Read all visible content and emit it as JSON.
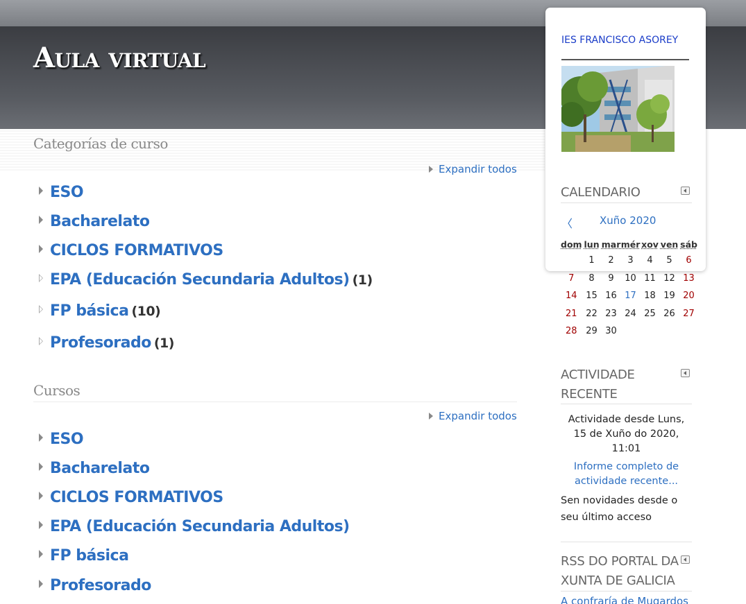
{
  "header": {
    "site_title": "Aula virtual"
  },
  "categories_section": {
    "title": "Categorías de curso",
    "expand_label": "Expandir todos",
    "items": [
      {
        "label": "ESO",
        "count": ""
      },
      {
        "label": "Bacharelato",
        "count": ""
      },
      {
        "label": "CICLOS FORMATIVOS",
        "count": ""
      },
      {
        "label": "EPA (Educación Secundaria Adultos)",
        "count": "(1)"
      },
      {
        "label": "FP básica",
        "count": "(10)"
      },
      {
        "label": "Profesorado",
        "count": "(1)"
      }
    ]
  },
  "courses_section": {
    "title": "Cursos",
    "expand_label": "Expandir todos",
    "items": [
      {
        "label": "ESO"
      },
      {
        "label": "Bacharelato"
      },
      {
        "label": "CICLOS FORMATIVOS"
      },
      {
        "label": "EPA (Educación Secundaria Adultos)"
      },
      {
        "label": "FP básica"
      },
      {
        "label": "Profesorado"
      }
    ]
  },
  "sidebar": {
    "school_name": "IES FRANCISCO ASOREY",
    "calendar": {
      "title": "CALENDARIO",
      "prev_symbol": "〈",
      "month": "Xuño 2020",
      "weekdays": [
        "dom",
        "lun",
        "mar",
        "mér",
        "xov",
        "ven",
        "sáb"
      ],
      "weeks": [
        [
          "",
          "1",
          "2",
          "3",
          "4",
          "5",
          "6"
        ],
        [
          "7",
          "8",
          "9",
          "10",
          "11",
          "12",
          "13"
        ],
        [
          "14",
          "15",
          "16",
          "17",
          "18",
          "19",
          "20"
        ],
        [
          "21",
          "22",
          "23",
          "24",
          "25",
          "26",
          "27"
        ],
        [
          "28",
          "29",
          "30",
          "",
          "",
          "",
          ""
        ]
      ],
      "today": "17"
    },
    "recent": {
      "title_line1": "ACTIVIDADE",
      "title_line2": "RECENTE",
      "since_line1": "Actividade desde Luns,",
      "since_line2": "15 de Xuño do 2020,",
      "since_line3": "11:01",
      "report_line1": "Informe completo de",
      "report_line2": "actividade recente...",
      "none_line1": "Sen novidades desde o",
      "none_line2": "seu último acceso"
    },
    "rss": {
      "title_line1": "RSS DO PORTAL DA",
      "title_line2": "XUNTA DE GALICIA",
      "first_item": "A confraría de Mugardos"
    }
  },
  "colors": {
    "link": "#2d6fc1",
    "weekend": "#a00000",
    "banner": "#484b50"
  }
}
